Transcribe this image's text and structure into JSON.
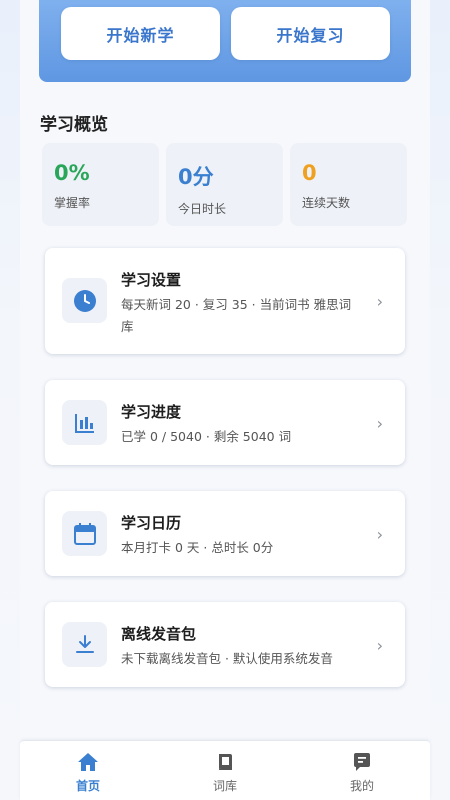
{
  "hero": {
    "new_label": "开始新学",
    "review_label": "开始复习"
  },
  "overview": {
    "title": "学习概览",
    "stats": [
      {
        "value": "0%",
        "label": "掌握率",
        "color": "#2aa65a"
      },
      {
        "value": "0分",
        "label": "今日时长",
        "color": "#3a7fd0"
      },
      {
        "value": "0",
        "label": "连续天数",
        "color": "#f0a020"
      }
    ]
  },
  "cards": [
    {
      "icon": "clock-icon",
      "title": "学习设置",
      "desc": "每天新词 20 · 复习 35 · 当前词书 雅思词库"
    },
    {
      "icon": "bar-chart-icon",
      "title": "学习进度",
      "desc": "已学 0 / 5040 · 剩余 5040 词"
    },
    {
      "icon": "calendar-icon",
      "title": "学习日历",
      "desc": "本月打卡 0 天 · 总时长 0分"
    },
    {
      "icon": "download-icon",
      "title": "离线发音包",
      "desc": "未下载离线发音包 · 默认使用系统发音"
    }
  ],
  "chevron": "›",
  "tabbar": {
    "tabs": [
      {
        "icon": "home-icon",
        "label": "首页",
        "active": true
      },
      {
        "icon": "book-icon",
        "label": "词库",
        "active": false
      },
      {
        "icon": "profile-icon",
        "label": "我的",
        "active": false
      }
    ]
  },
  "colors": {
    "accent": "#3a7fd0",
    "hero_top": "#7fb0ee",
    "hero_bottom": "#5f97e2"
  }
}
